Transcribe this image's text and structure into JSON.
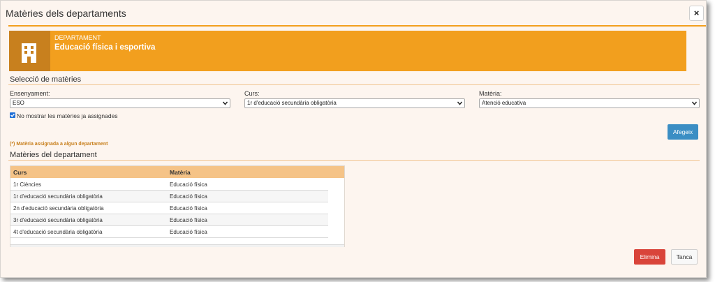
{
  "modal": {
    "title": "Matèries dels departaments",
    "close_glyph": "×"
  },
  "department": {
    "label": "DEPARTAMENT",
    "name": "Educació física i esportiva",
    "icon": "building-icon"
  },
  "selection": {
    "title": "Selecció de matèries",
    "ensenyament": {
      "label": "Ensenyament:",
      "value": "ESO"
    },
    "curs": {
      "label": "Curs:",
      "value": "1r d'educació secundària obligatòria"
    },
    "materia": {
      "label": "Matèria:",
      "value": "Atenció educativa"
    },
    "hide_assigned": {
      "label": "No mostrar les matèries ja assignades",
      "checked": true
    },
    "add_button": "Afegeix",
    "note": "(*) Matèria assignada a algun departament"
  },
  "table": {
    "title": "Matèries del departament",
    "columns": [
      "Curs",
      "Matèria"
    ],
    "rows": [
      [
        "1r Ciències",
        "Educació física"
      ],
      [
        "1r d'educació secundària obligatòria",
        "Educació física"
      ],
      [
        "2n d'educació secundària obligatòria",
        "Educació física"
      ],
      [
        "3r d'educació secundària obligatòria",
        "Educació física"
      ],
      [
        "4t d'educació secundària obligatòria",
        "Educació física"
      ]
    ]
  },
  "footer": {
    "delete_button": "Elimina",
    "close_button": "Tanca"
  },
  "colors": {
    "accent": "#f29f1e",
    "accent_dark": "#c8801e",
    "primary": "#3b8ec4",
    "danger": "#d9443a"
  }
}
